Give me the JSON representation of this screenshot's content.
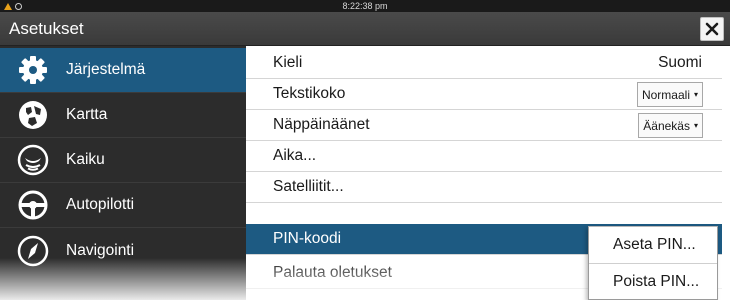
{
  "status_bar": {
    "time": "8:22:38 pm",
    "icons": [
      "warning-icon",
      "globe-icon"
    ]
  },
  "window": {
    "title": "Asetukset",
    "close_icon": "close-icon"
  },
  "sidebar": {
    "active_color": "#1d5a82",
    "items": [
      {
        "label": "Järjestelmä",
        "icon": "gear-icon",
        "active": true
      },
      {
        "label": "Kartta",
        "icon": "map-icon",
        "active": false
      },
      {
        "label": "Kaiku",
        "icon": "sonar-icon",
        "active": false
      },
      {
        "label": "Autopilotti",
        "icon": "steering-wheel-icon",
        "active": false
      },
      {
        "label": "Navigointi",
        "icon": "compass-icon",
        "active": false
      }
    ]
  },
  "settings": {
    "rows": [
      {
        "label": "Kieli",
        "value": "Suomi"
      },
      {
        "label": "Tekstikoko",
        "dropdown": "Normaali"
      },
      {
        "label": "Näppäinäänet",
        "dropdown": "Äänekäs"
      },
      {
        "label": "Aika..."
      },
      {
        "label": "Satelliitit..."
      },
      {
        "label": "PIN-koodi",
        "selected": true
      },
      {
        "label": "Palauta oletukset"
      }
    ]
  },
  "pin_menu": {
    "items": [
      "Aseta PIN...",
      "Poista PIN..."
    ]
  }
}
